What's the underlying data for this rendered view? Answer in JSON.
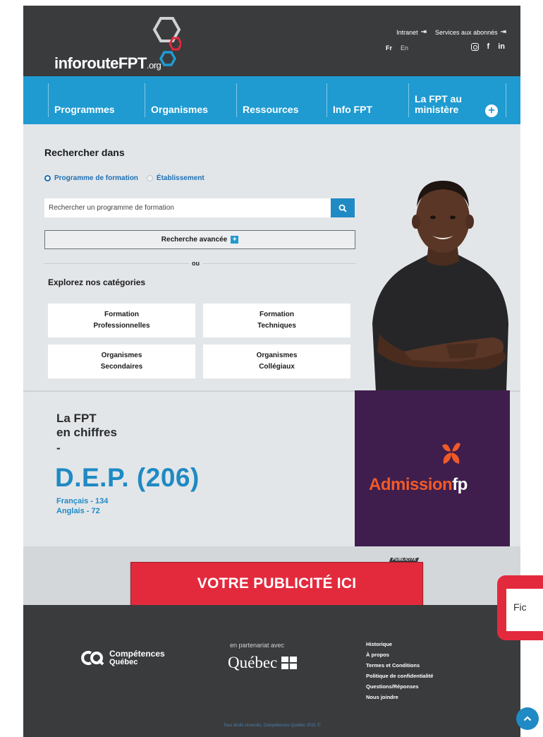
{
  "header": {
    "logo_text": "inforouteFPT",
    "logo_suffix": ".org",
    "intranet_label": "Intranet",
    "subscribers_label": "Services aux abonnés",
    "lang_fr": "Fr",
    "lang_en": "En",
    "social": {
      "facebook": "f",
      "linkedin": "in"
    }
  },
  "nav": {
    "items": [
      {
        "label": "Programmes"
      },
      {
        "label": "Organismes"
      },
      {
        "label": "Ressources"
      },
      {
        "label": "Info FPT"
      },
      {
        "label_line1": "La FPT au",
        "label_line2": "ministère"
      }
    ],
    "plus_glyph": "+"
  },
  "search": {
    "title": "Rechercher dans",
    "radio_program": "Programme de formation",
    "radio_establishment": "Établissement",
    "placeholder": "Rechercher un programme de formation",
    "advanced_label": "Recherche avancée",
    "or_text": "ou"
  },
  "categories": {
    "title": "Explorez nos catégories",
    "tiles": [
      {
        "line1": "Formation",
        "line2": "Professionnelles"
      },
      {
        "line1": "Formation",
        "line2": "Techniques"
      },
      {
        "line1": "Organismes",
        "line2": "Secondaires"
      },
      {
        "line1": "Organismes",
        "line2": "Collégiaux"
      }
    ]
  },
  "stats": {
    "title_line1": "La FPT",
    "title_line2": "en chiffres",
    "dash": "-",
    "big": "D.E.P. (206)",
    "sub_line1": "Français - 134",
    "sub_line2": "Anglais - 72"
  },
  "admission": {
    "text_main": "Admission",
    "text_fp": "fp"
  },
  "ad": {
    "tag": "PUBLICITÉ",
    "banner": "VOTRE PUBLICITÉ ICI"
  },
  "footer": {
    "comp_line1": "Compétences",
    "comp_line2": "Québec",
    "partner": "en partenariat avec",
    "quebec": "Québec",
    "links": [
      "Historique",
      "À propos",
      "Termes et Conditions",
      "Politique de confidentialité",
      "Questions/Réponses",
      "Nous joindre"
    ],
    "copyright": "Tous droits réservés, Compétences Québec 2021 ©"
  },
  "chat": {
    "text": "Fic"
  },
  "colors": {
    "accent_blue": "#1f9bd1",
    "dark": "#3a3b3d",
    "ad_red": "#e32a3d",
    "admission_purple": "#3f1e4e"
  }
}
